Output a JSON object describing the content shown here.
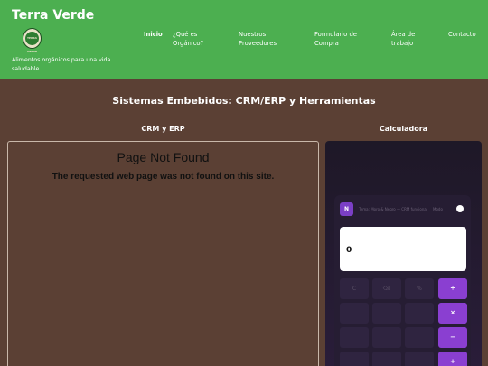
{
  "brand": {
    "name": "Terra Verde",
    "tagline": "Alimentos orgánicos para una vida saludable",
    "logo_text": "TERRA VERDE"
  },
  "nav": [
    {
      "label": "Inicio",
      "active": true
    },
    {
      "label": "¿Qué es Orgánico?"
    },
    {
      "label": "Nuestros Proveedores"
    },
    {
      "label": "Formulario de Compra"
    },
    {
      "label": "Área de trabajo"
    },
    {
      "label": "Contacto"
    }
  ],
  "main": {
    "title": "Sistemas Embebidos: CRM/ERP y Herramientas",
    "crm": {
      "title": "CRM y ERP",
      "not_found_title": "Page Not Found",
      "not_found_message": "The requested web page was not found on this site."
    },
    "calc": {
      "title": "Calculadora",
      "badge": "N",
      "meta": "Tema: Moro & Negro — CRM funcional",
      "mode": "Modo",
      "display": "0",
      "keys": [
        "C",
        "⌫",
        "%",
        "÷",
        "×",
        "−",
        "+"
      ]
    }
  },
  "colors": {
    "header": "#4caf50",
    "background": "#5b4034",
    "accent": "#8a3fd1"
  }
}
